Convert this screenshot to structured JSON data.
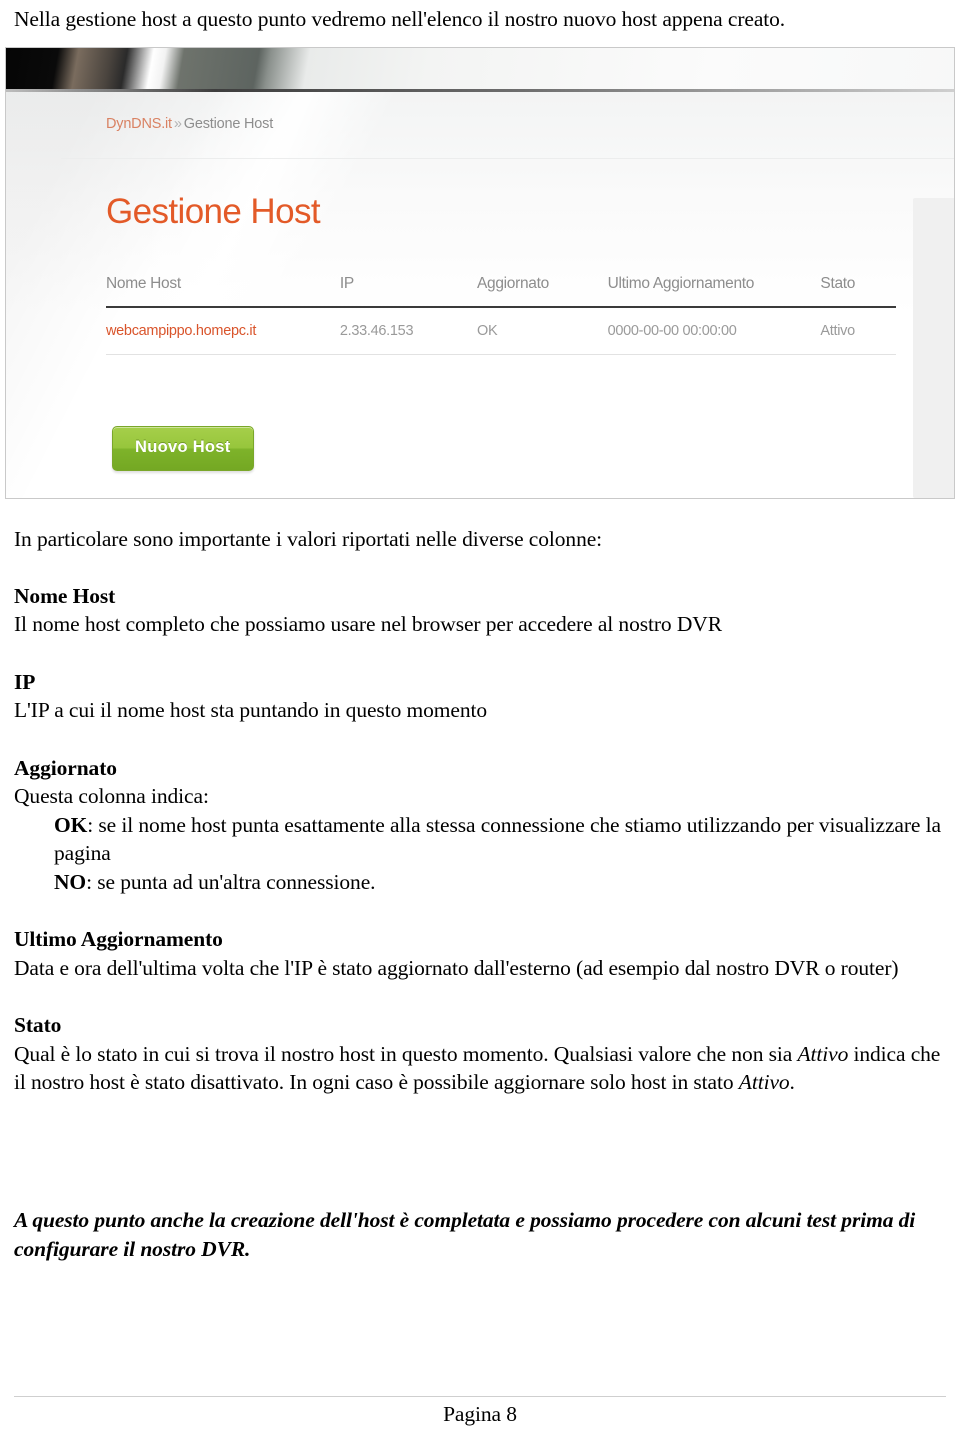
{
  "document": {
    "intro_line": "Nella gestione host a questo punto vedremo nell'elenco il nostro nuovo host appena creato.",
    "lead_in": "In particolare sono importante i valori riportati nelle diverse colonne:",
    "sections": [
      {
        "heading": "Nome Host",
        "body": "Il nome host completo che possiamo usare nel browser per accedere al nostro DVR"
      },
      {
        "heading": "IP",
        "body": "L'IP a cui il nome host sta puntando in questo momento"
      },
      {
        "heading": "Aggiornato",
        "body": "Questa colonna indica:",
        "bullets": [
          {
            "term": "OK",
            "text": ": se il nome host punta esattamente alla stessa connessione che stiamo utilizzando per visualizzare la pagina"
          },
          {
            "term": "NO",
            "text": ": se punta ad un'altra connessione."
          }
        ]
      },
      {
        "heading": "Ultimo Aggiornamento",
        "body": "Data e ora dell'ultima volta che l'IP è stato aggiornato dall'esterno (ad esempio dal nostro DVR o router)"
      },
      {
        "heading": "Stato",
        "body_part_1": "Qual è lo stato in cui si trova il nostro host in questo momento. Qualsiasi valore che non sia ",
        "body_emph_1": "Attivo",
        "body_part_2": " indica che il nostro host è stato disattivato. In ogni caso è possibile aggiornare solo host in stato ",
        "body_emph_2": "Attivo",
        "body_part_3": "."
      }
    ],
    "closing": "A questo punto anche la creazione dell'host è completata e possiamo procedere con alcuni test prima di configurare il nostro DVR.",
    "footer": "Pagina 8"
  },
  "screenshot": {
    "breadcrumb": {
      "site": "DynDNS.it",
      "separator": "»",
      "current": "Gestione Host"
    },
    "title": "Gestione Host",
    "table": {
      "columns": [
        "Nome Host",
        "IP",
        "Aggiornato",
        "Ultimo Aggiornamento",
        "Stato"
      ],
      "rows": [
        {
          "host": "webcampippo.homepc.it",
          "ip": "2.33.46.153",
          "aggiornato": "OK",
          "ultimo_aggiornamento": "0000-00-00 00:00:00",
          "stato": "Attivo"
        }
      ]
    },
    "new_host_button": "Nuovo Host",
    "colors": {
      "accent_orange": "#e35a28",
      "link_orange": "#d9542b",
      "button_green": "#8cbe34",
      "muted_gray": "#9a9a9a"
    }
  }
}
